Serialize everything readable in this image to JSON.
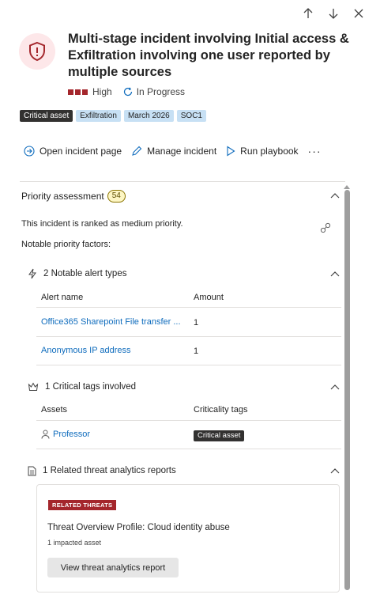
{
  "panel": {
    "title": "Multi-stage incident involving Initial access & Exfiltration involving one user reported by multiple sources",
    "severity": "High",
    "status": "In Progress",
    "colors": {
      "severity": "#a4262c",
      "link": "#0f6cbd",
      "accent_bg": "#fde7e9"
    }
  },
  "tags": [
    "Critical asset",
    "Exfiltration",
    "March 2026",
    "SOC1"
  ],
  "actions": {
    "open": "Open incident page",
    "manage": "Manage incident",
    "playbook": "Run playbook",
    "more": "···"
  },
  "priority": {
    "title": "Priority assessment",
    "score": "54",
    "ranked_text": "This incident is ranked as medium priority.",
    "notable_text": "Notable priority factors:"
  },
  "alerts": {
    "title": "2 Notable alert types",
    "columns": [
      "Alert name",
      "Amount"
    ],
    "rows": [
      {
        "name": "Office365 Sharepoint File transfer ...",
        "amount": "1"
      },
      {
        "name": "Anonymous IP address",
        "amount": "1"
      }
    ]
  },
  "critical": {
    "title": "1 Critical tags involved",
    "columns": [
      "Assets",
      "Criticality tags"
    ],
    "rows": [
      {
        "asset": "Professor",
        "tag": "Critical asset"
      }
    ]
  },
  "threats": {
    "title": "1 Related threat analytics reports",
    "badge": "RELATED THREATS",
    "report_title": "Threat Overview Profile: Cloud identity abuse",
    "impacted": "1 impacted asset",
    "button": "View threat analytics report"
  }
}
